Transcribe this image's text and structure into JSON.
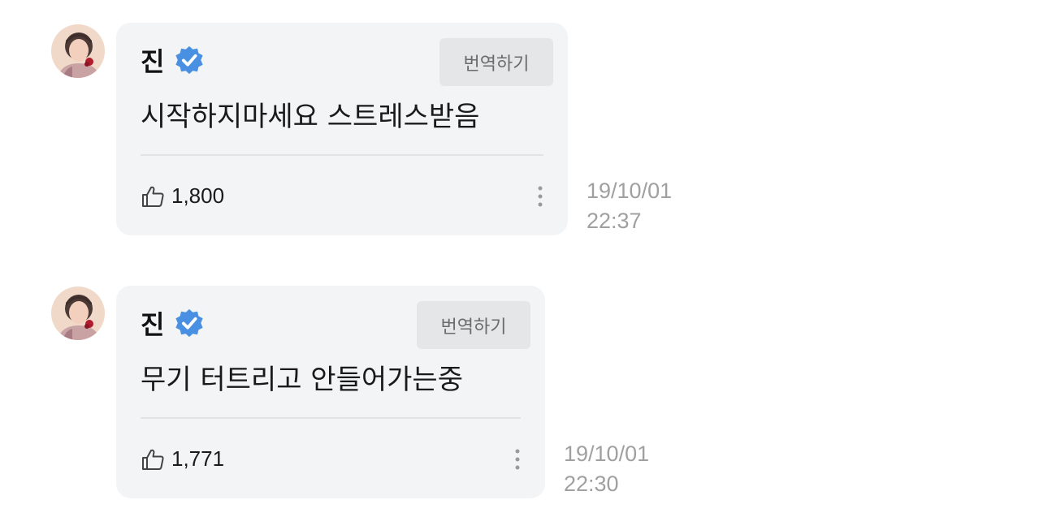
{
  "messages": [
    {
      "author": "진",
      "translate_label": "번역하기",
      "text": "시작하지마세요 스트레스받음",
      "likes": "1,800",
      "date": "19/10/01",
      "time": "22:37"
    },
    {
      "author": "진",
      "translate_label": "번역하기",
      "text": "무기 터트리고 안들어가는중",
      "likes": "1,771",
      "date": "19/10/01",
      "time": "22:30"
    }
  ],
  "icons": {
    "verified": "verified-badge-icon",
    "like": "thumbs-up-icon",
    "more": "vertical-dots-icon"
  },
  "colors": {
    "verified_badge": "#4a90e2",
    "bubble_background": "#f3f4f6",
    "translate_button": "#e5e6e8",
    "timestamp_text": "#a0a0a0"
  }
}
